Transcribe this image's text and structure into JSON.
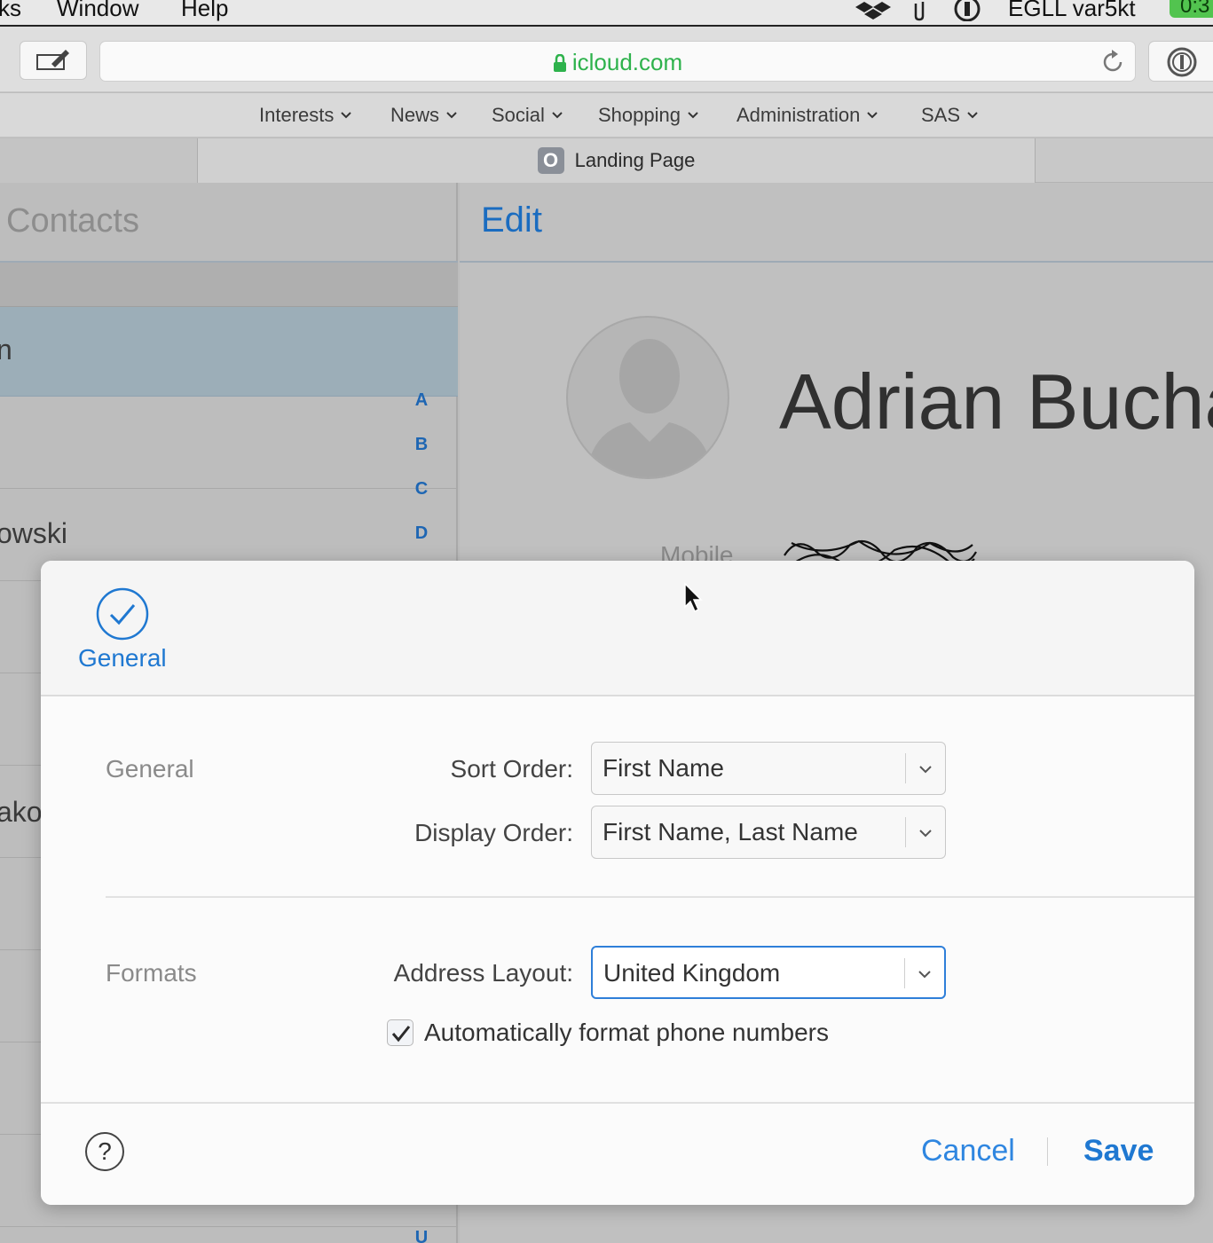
{
  "menubar": {
    "items": [
      "ks",
      "Window",
      "Help"
    ],
    "tray_text": "EGLL var5kt",
    "clock": "0:3",
    "icons": [
      "dropbox-icon",
      "paperclip-icon",
      "1password-icon"
    ]
  },
  "toolbar": {
    "url": "icloud.com",
    "lock_icon": "lock-icon",
    "reload_icon": "reload-icon",
    "compose_icon": "compose-icon"
  },
  "favorites": [
    {
      "label": "Interests"
    },
    {
      "label": "News"
    },
    {
      "label": "Social"
    },
    {
      "label": "Shopping"
    },
    {
      "label": "Administration"
    },
    {
      "label": "SAS"
    }
  ],
  "tab": {
    "favicon_letter": "O",
    "title": "Landing Page"
  },
  "contacts": {
    "list_title": "l Contacts",
    "rows": [
      {
        "name": "n"
      },
      {
        "name": "owski"
      },
      {
        "name": "ako"
      }
    ],
    "az_index": [
      "A",
      "B",
      "C",
      "D",
      "U"
    ],
    "edit_label": "Edit",
    "contact_name": "Adrian Bucha",
    "mobile_label": "Mobile"
  },
  "preferences": {
    "tab_label": "General",
    "general_section": "General",
    "sort_order_label": "Sort Order:",
    "sort_order_value": "First Name",
    "display_order_label": "Display Order:",
    "display_order_value": "First Name, Last Name",
    "formats_section": "Formats",
    "address_layout_label": "Address Layout:",
    "address_layout_value": "United Kingdom",
    "auto_format_label": "Automatically format phone numbers",
    "auto_format_checked": true,
    "help_label": "?",
    "cancel_label": "Cancel",
    "save_label": "Save"
  },
  "colors": {
    "accent": "#1f78d1",
    "url_green": "#2eb24c",
    "clock_green": "#52c44f"
  }
}
